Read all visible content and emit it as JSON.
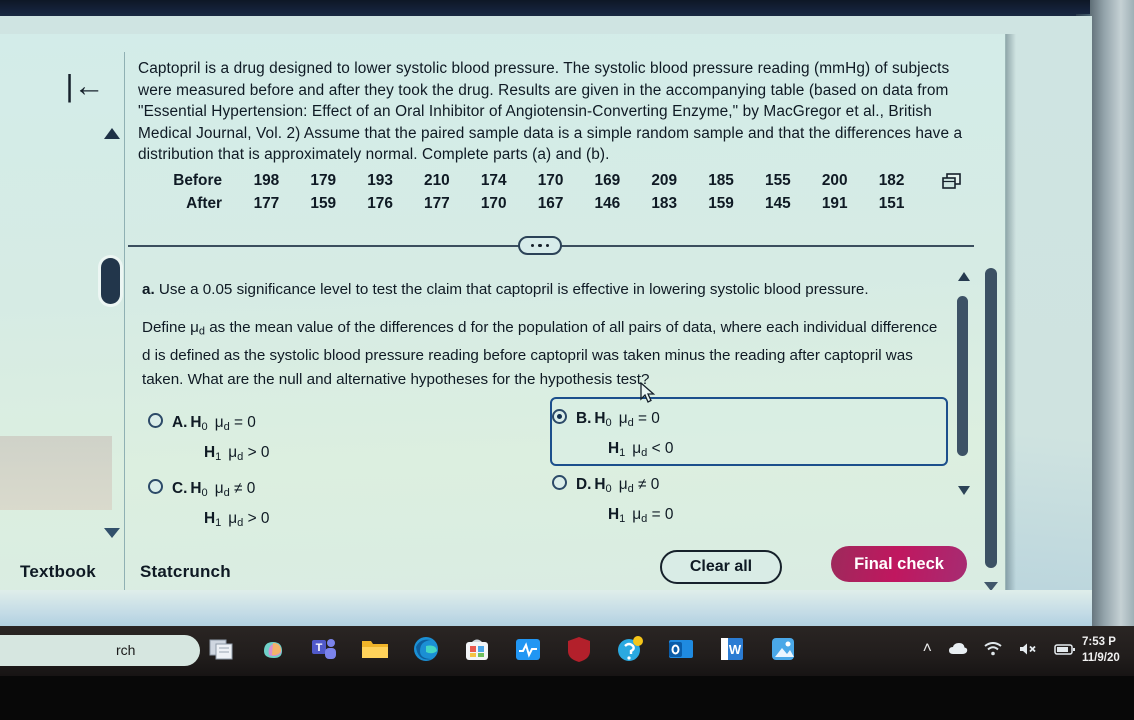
{
  "problem": {
    "paragraph": "Captopril is a drug designed to lower systolic blood pressure. The systolic blood pressure reading (mmHg) of subjects were measured before and after they took the drug. Results are given in the accompanying table (based on data from \"Essential Hypertension: Effect of an Oral Inhibitor of Angiotensin-Converting Enzyme,\" by MacGregor et al., British Medical Journal, Vol. 2) Assume that the paired sample data is a simple random sample and that the differences have a distribution that is approximately normal. Complete parts (a) and (b)."
  },
  "data_table": {
    "row_labels": [
      "Before",
      "After"
    ],
    "before": [
      "198",
      "179",
      "193",
      "210",
      "174",
      "170",
      "169",
      "209",
      "185",
      "155",
      "200",
      "182"
    ],
    "after": [
      "177",
      "159",
      "176",
      "177",
      "170",
      "167",
      "146",
      "183",
      "159",
      "145",
      "191",
      "151"
    ],
    "copy_icon": "copy-to-spreadsheet-icon"
  },
  "part_a": {
    "label": "a.",
    "prompt": "Use a 0.05 significance level to test the claim that captopril is effective in lowering systolic blood pressure.",
    "define_line_1_pre": "Define ",
    "define_mu": "μ",
    "define_mu_sub": "d",
    "define_line_1_post": " as the mean value of the differences d for the population of all pairs of data, where each individual",
    "define_line_2": "difference d is defined as the systolic blood pressure reading before captopril was taken minus the reading after",
    "define_line_3": "captopril was taken. What are the null and alternative hypotheses for the hypothesis test?"
  },
  "options": [
    {
      "letter": "A.",
      "name": "option-a",
      "selected": false,
      "null_label": "H",
      "null_sub": "0",
      "null_expr": "μ",
      "null_expr_sub": "d",
      "null_rel": "= 0",
      "alt_label": "H",
      "alt_sub": "1",
      "alt_expr": "μ",
      "alt_expr_sub": "d",
      "alt_rel": "> 0"
    },
    {
      "letter": "B.",
      "name": "option-b",
      "selected": true,
      "null_label": "H",
      "null_sub": "0",
      "null_expr": "μ",
      "null_expr_sub": "d",
      "null_rel": "= 0",
      "alt_label": "H",
      "alt_sub": "1",
      "alt_expr": "μ",
      "alt_expr_sub": "d",
      "alt_rel": "< 0"
    },
    {
      "letter": "C.",
      "name": "option-c",
      "selected": false,
      "null_label": "H",
      "null_sub": "0",
      "null_expr": "μ",
      "null_expr_sub": "d",
      "null_rel": "≠ 0",
      "alt_label": "H",
      "alt_sub": "1",
      "alt_expr": "μ",
      "alt_expr_sub": "d",
      "alt_rel": "> 0"
    },
    {
      "letter": "D.",
      "name": "option-d",
      "selected": false,
      "null_label": "H",
      "null_sub": "0",
      "null_expr": "μ",
      "null_expr_sub": "d",
      "null_rel": "≠ 0",
      "alt_label": "H",
      "alt_sub": "1",
      "alt_expr": "μ",
      "alt_expr_sub": "d",
      "alt_rel": "= 0"
    }
  ],
  "actions": {
    "textbook": "Textbook",
    "statcrunch": "Statcrunch",
    "clear_all": "Clear all",
    "final_check": "Final check",
    "final_check_color": "#c0175f"
  },
  "nav": {
    "back_to_start_icon": "back-to-start-icon",
    "back_to_start_glyph": "|←",
    "more_options_icon": "ellipsis-icon"
  },
  "taskbar": {
    "search_text": "rch",
    "icons": [
      "task-view-icon",
      "copilot-icon",
      "microsoft-teams-icon",
      "file-explorer-icon",
      "microsoft-edge-icon",
      "microsoft-store-icon",
      "health-monitor-icon",
      "security-shield-icon",
      "help-circle-icon",
      "microsoft-outlook-icon",
      "microsoft-word-icon",
      "photos-icon"
    ],
    "tray": {
      "chevron_up": "˄",
      "onedrive_icon": "cloud-icon",
      "wifi_icon": "wifi-icon",
      "volume_icon": "speaker-muted-icon",
      "battery_icon": "battery-icon"
    },
    "clock_time": "7:53 P",
    "clock_date": "11/9/20"
  }
}
